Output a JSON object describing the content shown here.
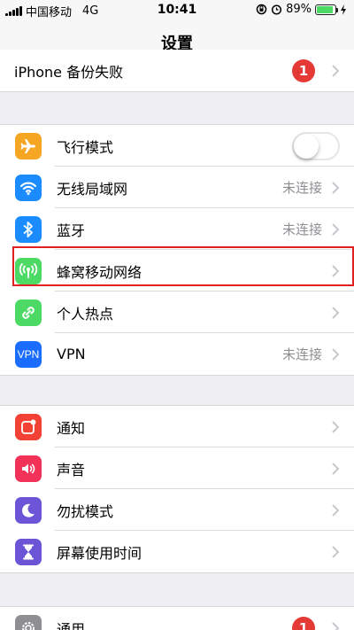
{
  "status_bar": {
    "carrier": "中国移动",
    "network": "4G",
    "time": "10:41",
    "battery": "89%",
    "battery_level": 0.89
  },
  "nav": {
    "title": "设置"
  },
  "backup_row": {
    "label": "iPhone 备份失败",
    "badge": "1"
  },
  "connectivity": [
    {
      "label": "飞行模式",
      "icon": "airplane-icon",
      "color": "#f5a623",
      "toggle": false
    },
    {
      "label": "无线局域网",
      "icon": "wifi-icon",
      "color": "#1a8cff",
      "value": "未连接"
    },
    {
      "label": "蓝牙",
      "icon": "bluetooth-icon",
      "color": "#1a8cff",
      "value": "未连接"
    },
    {
      "label": "蜂窝移动网络",
      "icon": "cellular-icon",
      "color": "#4cd964"
    },
    {
      "label": "个人热点",
      "icon": "hotspot-icon",
      "color": "#4cd964"
    },
    {
      "label": "VPN",
      "icon": "vpn-icon",
      "color": "#1a6dff",
      "value": "未连接",
      "icon_text": "VPN"
    }
  ],
  "notifications": [
    {
      "label": "通知",
      "icon": "notification-icon",
      "color": "#f34235"
    },
    {
      "label": "声音",
      "icon": "sound-icon",
      "color": "#f3325a"
    },
    {
      "label": "勿扰模式",
      "icon": "moon-icon",
      "color": "#6b55d6"
    },
    {
      "label": "屏幕使用时间",
      "icon": "hourglass-icon",
      "color": "#6b55d6"
    }
  ],
  "general_row": {
    "label": "通用",
    "icon": "gear-icon",
    "color": "#8e8e93",
    "badge": "1"
  }
}
